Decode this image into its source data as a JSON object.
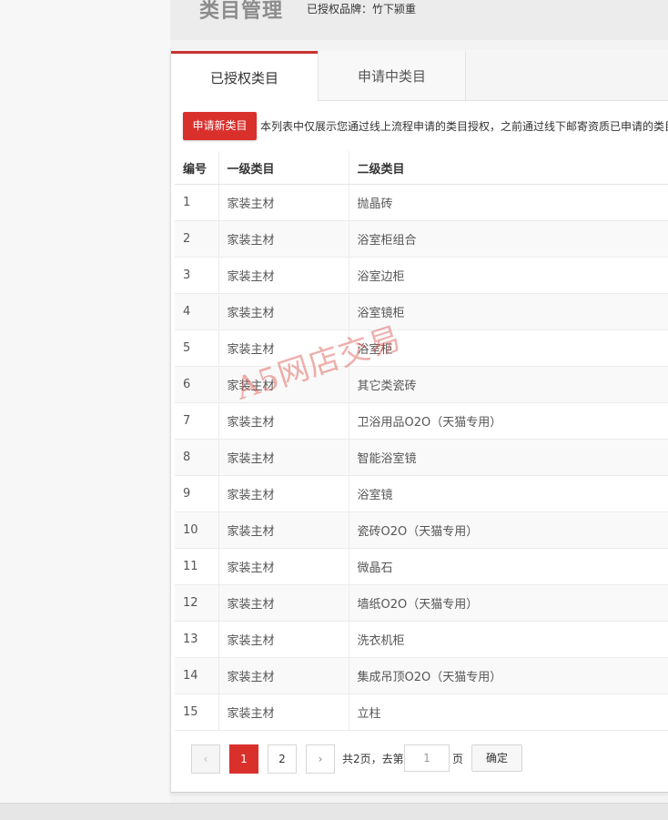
{
  "header": {
    "title": "类目管理",
    "brand_label": "已授权品牌：竹下颍重"
  },
  "tabs": [
    {
      "label": "已授权类目",
      "active": true
    },
    {
      "label": "申请中类目",
      "active": false
    }
  ],
  "toolbar": {
    "apply_label": "申请新类目",
    "notice": "本列表中仅展示您通过线上流程申请的类目授权，之前通过线下邮寄资质已申请的类目"
  },
  "table": {
    "columns": [
      "编号",
      "一级类目",
      "二级类目"
    ],
    "rows": [
      [
        "1",
        "家装主材",
        "抛晶砖"
      ],
      [
        "2",
        "家装主材",
        "浴室柜组合"
      ],
      [
        "3",
        "家装主材",
        "浴室边柜"
      ],
      [
        "4",
        "家装主材",
        "浴室镜柜"
      ],
      [
        "5",
        "家装主材",
        "浴室柜"
      ],
      [
        "6",
        "家装主材",
        "其它类瓷砖"
      ],
      [
        "7",
        "家装主材",
        "卫浴用品O2O（天猫专用）"
      ],
      [
        "8",
        "家装主材",
        "智能浴室镜"
      ],
      [
        "9",
        "家装主材",
        "浴室镜"
      ],
      [
        "10",
        "家装主材",
        "瓷砖O2O（天猫专用）"
      ],
      [
        "11",
        "家装主材",
        "微晶石"
      ],
      [
        "12",
        "家装主材",
        "墙纸O2O（天猫专用）"
      ],
      [
        "13",
        "家装主材",
        "洗衣机柜"
      ],
      [
        "14",
        "家装主材",
        "集成吊顶O2O（天猫专用）"
      ],
      [
        "15",
        "家装主材",
        "立柱"
      ]
    ]
  },
  "pagination": {
    "prev": "‹",
    "next": "›",
    "pages": [
      "1",
      "2"
    ],
    "current": "1",
    "total_text": "共2页，去第",
    "input_value": "1",
    "suffix": "页",
    "confirm_label": "确定"
  },
  "watermark": "A5网店交易",
  "colors": {
    "accent": "#d9302c",
    "tab_border": "#c8322e"
  }
}
